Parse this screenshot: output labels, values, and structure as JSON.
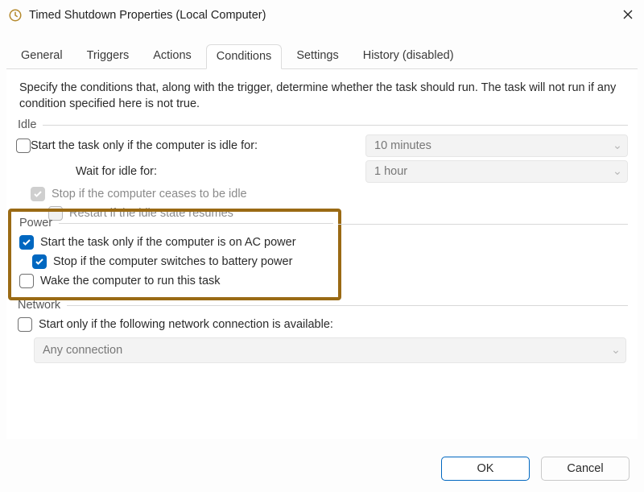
{
  "window": {
    "title": "Timed Shutdown Properties (Local Computer)"
  },
  "tabs": {
    "general": "General",
    "triggers": "Triggers",
    "actions": "Actions",
    "conditions": "Conditions",
    "settings": "Settings",
    "history": "History (disabled)",
    "active": "conditions"
  },
  "description": "Specify the conditions that, along with the trigger, determine whether the task should run.  The task will not run  if any condition specified here is not true.",
  "sections": {
    "idle": {
      "title": "Idle",
      "start_only_idle": "Start the task only if the computer is idle for:",
      "idle_duration": "10 minutes",
      "wait_label": "Wait for idle for:",
      "wait_duration": "1 hour",
      "stop_if_not_idle": "Stop if the computer ceases to be idle",
      "restart_if_idle": "Restart if the idle state resumes"
    },
    "power": {
      "title": "Power",
      "start_on_ac": "Start the task only if the computer is on AC power",
      "stop_on_battery": "Stop if the computer switches to battery power",
      "wake": "Wake the computer to run this task"
    },
    "network": {
      "title": "Network",
      "start_if_conn": "Start only if the following network connection is available:",
      "connection": "Any connection"
    }
  },
  "buttons": {
    "ok": "OK",
    "cancel": "Cancel"
  }
}
